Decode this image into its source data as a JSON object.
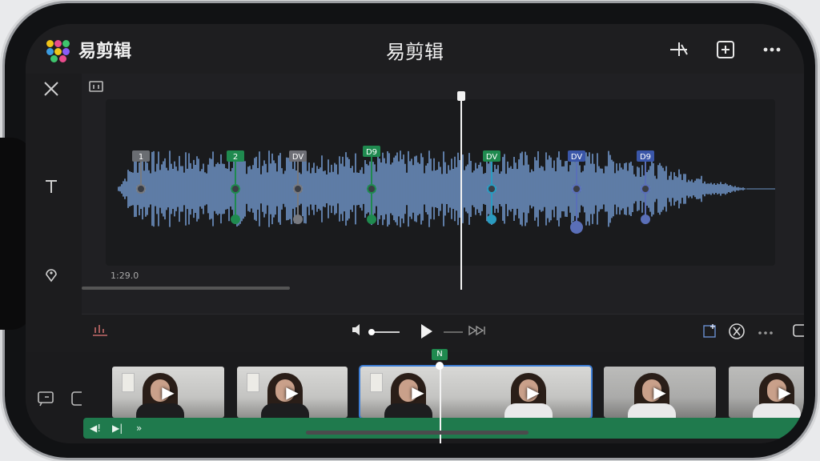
{
  "header": {
    "app_name": "易剪辑",
    "title": "易剪辑",
    "icons": [
      "trim-icon",
      "add-box-icon",
      "more-icon"
    ]
  },
  "left_toolbar": {
    "icons": [
      "close-icon",
      "text-icon",
      "location-pin-icon"
    ]
  },
  "editor": {
    "time_label": "1:29.0",
    "marker_labels": [
      "1",
      "2",
      "DV",
      "D9",
      "DV",
      "DV",
      "D9"
    ]
  },
  "controls": {
    "icons": [
      "volume-icon",
      "play-icon",
      "skip-forward-icon",
      "add-clip-icon",
      "cut-icon",
      "more-horizontal-icon",
      "aspect-ratio-icon"
    ]
  },
  "timeline": {
    "playhead_badge": "N",
    "clips": [
      {
        "shirt": "dark"
      },
      {
        "shirt": "dark"
      },
      {
        "shirt": "dark"
      },
      {
        "shirt": "white"
      },
      {
        "shirt": "white"
      },
      {
        "shirt": "white"
      }
    ],
    "audio_controls": [
      "◀!",
      "▶|",
      "»"
    ]
  },
  "colors": {
    "accent_green": "#1f8a4f",
    "accent_blue": "#3d7ed6",
    "waveform": "#6f95c8"
  }
}
